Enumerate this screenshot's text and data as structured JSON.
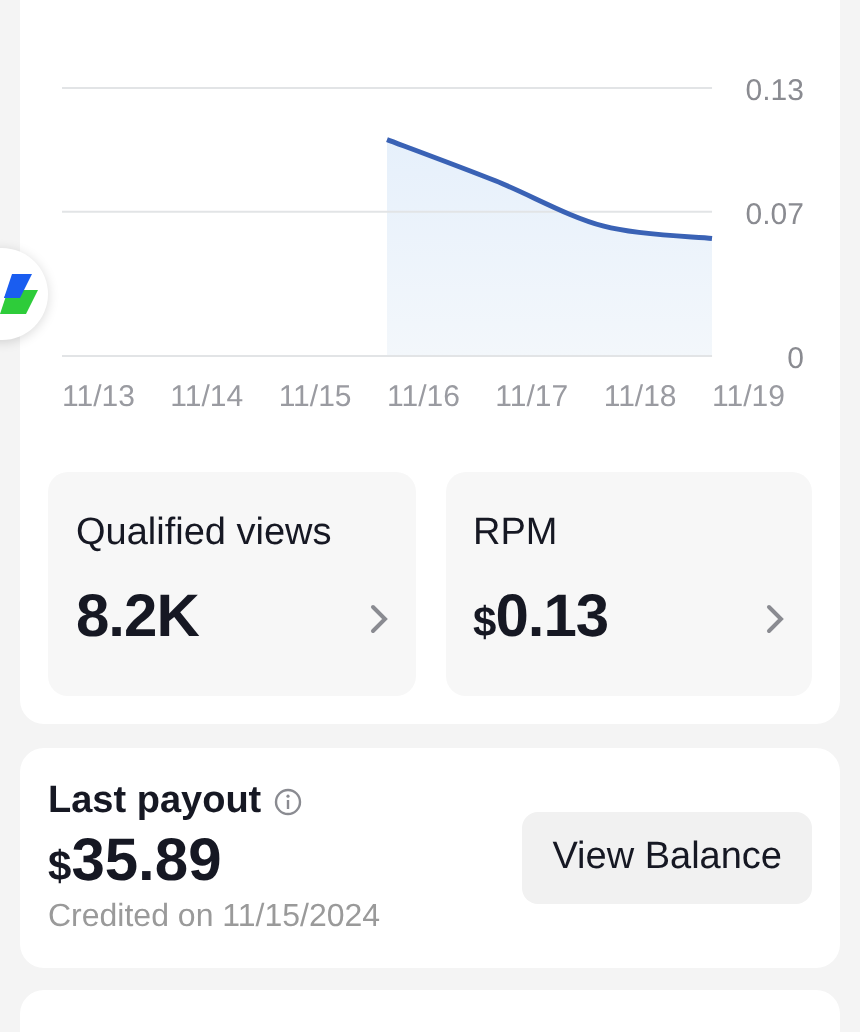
{
  "chart": {
    "chart_data": {
      "type": "area",
      "x": [
        "11/13",
        "11/14",
        "11/15",
        "11/16",
        "11/17",
        "11/18",
        "11/19"
      ],
      "series": [
        {
          "color": "#3a62b5",
          "values": [
            null,
            null,
            null,
            0.105,
            0.085,
            0.063,
            0.057
          ]
        }
      ],
      "ylim": [
        0,
        0.13
      ],
      "yticks": [
        0,
        0.07,
        0.13
      ]
    }
  },
  "metrics": [
    {
      "label": "Qualified views",
      "value": "8.2K"
    },
    {
      "label": "RPM",
      "currency": "$",
      "value": "0.13"
    }
  ],
  "payout": {
    "title": "Last payout",
    "currency": "$",
    "amount": "35.89",
    "note": "Credited on 11/15/2024",
    "button": "View Balance"
  }
}
